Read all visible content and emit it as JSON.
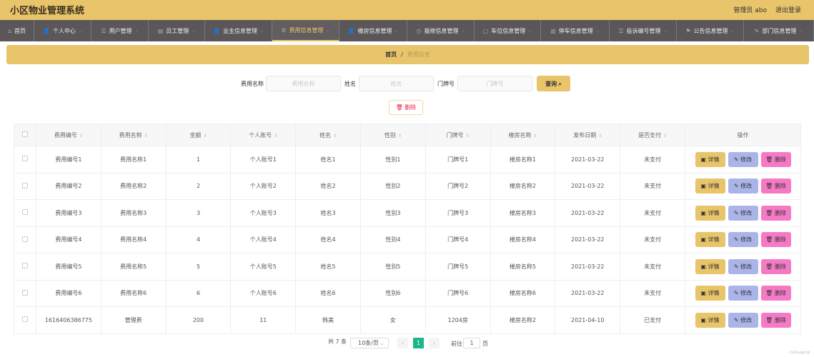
{
  "app": {
    "title": "小区物业管理系统",
    "user": "管理员 abo",
    "logout": "退出登录"
  },
  "nav": [
    {
      "label": "首页",
      "icon": "home-icon",
      "glyph": "⌂",
      "w": 48
    },
    {
      "label": "个人中心",
      "icon": "user-icon",
      "glyph": "👤",
      "w": 80
    },
    {
      "label": "用户管理",
      "icon": "list-icon",
      "glyph": "☰",
      "w": 80
    },
    {
      "label": "员工管理",
      "icon": "monitor-icon",
      "glyph": "▤",
      "w": 79
    },
    {
      "label": "业主信息管理",
      "icon": "user-icon",
      "glyph": "👤",
      "w": 94
    },
    {
      "label": "费用信息管理",
      "icon": "settings-icon",
      "glyph": "⚙",
      "w": 94,
      "active": true
    },
    {
      "label": "楼房信息管理",
      "icon": "user-icon",
      "glyph": "👤",
      "w": 95
    },
    {
      "label": "报修信息管理",
      "icon": "clock-icon",
      "glyph": "◷",
      "w": 94
    },
    {
      "label": "车位信息管理",
      "icon": "clipboard-icon",
      "glyph": "▢",
      "w": 93
    },
    {
      "label": "停车信息管理",
      "icon": "chart-icon",
      "glyph": "▥",
      "w": 96
    },
    {
      "label": "投诉编号管理",
      "icon": "list-icon",
      "glyph": "☰",
      "w": 94
    },
    {
      "label": "公告信息管理",
      "icon": "flag-icon",
      "glyph": "⚑",
      "w": 94
    },
    {
      "label": "部门信息管理",
      "icon": "edit-icon",
      "glyph": "✎",
      "w": 98
    }
  ],
  "breadcrumb": {
    "home": "首页",
    "sep": "/",
    "current": "费用信息"
  },
  "search": {
    "fee_name_label": "费用名称",
    "fee_name_placeholder": "费用名称",
    "name_label": "姓名",
    "name_placeholder": "姓名",
    "door_label": "门牌号",
    "door_placeholder": "门牌号",
    "query": "查询 ⌕"
  },
  "batch_delete": "🗑 删除",
  "table": {
    "columns": [
      "费用编号",
      "费用名称",
      "金额",
      "个人账号",
      "姓名",
      "性别",
      "门牌号",
      "楼房名称",
      "发布日期",
      "是否支付"
    ],
    "actions_header": "操作",
    "actions": {
      "detail": "▣ 详情",
      "edit": "✎ 修改",
      "delete": "🗑 删除"
    },
    "rows": [
      [
        "费用编号1",
        "费用名称1",
        "1",
        "个人账号1",
        "姓名1",
        "性别1",
        "门牌号1",
        "楼房名称1",
        "2021-03-22",
        "未支付"
      ],
      [
        "费用编号2",
        "费用名称2",
        "2",
        "个人账号2",
        "姓名2",
        "性别2",
        "门牌号2",
        "楼房名称2",
        "2021-03-22",
        "未支付"
      ],
      [
        "费用编号3",
        "费用名称3",
        "3",
        "个人账号3",
        "姓名3",
        "性别3",
        "门牌号3",
        "楼房名称3",
        "2021-03-22",
        "未支付"
      ],
      [
        "费用编号4",
        "费用名称4",
        "4",
        "个人账号4",
        "姓名4",
        "性别4",
        "门牌号4",
        "楼房名称4",
        "2021-03-22",
        "未支付"
      ],
      [
        "费用编号5",
        "费用名称5",
        "5",
        "个人账号5",
        "姓名5",
        "性别5",
        "门牌号5",
        "楼房名称5",
        "2021-03-22",
        "未支付"
      ],
      [
        "费用编号6",
        "费用名称6",
        "6",
        "个人账号6",
        "姓名6",
        "性别6",
        "门牌号6",
        "楼房名称6",
        "2021-03-22",
        "未支付"
      ],
      [
        "1616406386775",
        "管理费",
        "200",
        "11",
        "韩美",
        "女",
        "1204房",
        "楼房名称2",
        "2021-04-10",
        "已支付"
      ]
    ]
  },
  "pagination": {
    "total": "共 7 条",
    "page_size": "10条/页",
    "current": "1",
    "goto": "前往",
    "goto_value": "1",
    "page_unit": "页",
    "prev": "‹",
    "next": "›"
  },
  "watermark": "CSDN @福大猪"
}
